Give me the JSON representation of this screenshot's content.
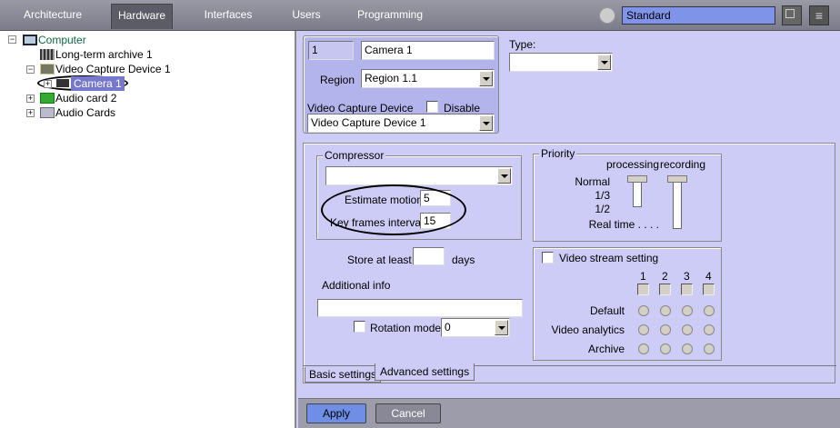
{
  "topbar": {
    "tabs": [
      "Architecture",
      "Hardware",
      "Interfaces",
      "Users",
      "Programming"
    ],
    "active_tab": "Hardware",
    "layout_select": "Standard"
  },
  "tree": {
    "items": [
      {
        "label": "Computer"
      },
      {
        "label": "Long-term archive 1"
      },
      {
        "label": "Video Capture Device 1"
      },
      {
        "label": "Camera 1"
      },
      {
        "label": "Audio card 2"
      },
      {
        "label": "Audio Cards"
      }
    ]
  },
  "camera": {
    "id": "1",
    "name": "Camera 1",
    "region_label": "Region",
    "region_value": "Region 1.1",
    "vcd_label": "Video Capture Device",
    "disable_label": "Disable",
    "vcd_value": "Video Capture Device 1",
    "type_label": "Type:",
    "type_value": ""
  },
  "compressor": {
    "title": "Compressor",
    "value": "",
    "estimate_motion_label": "Estimate motion",
    "estimate_motion_value": "5",
    "key_frames_label": "Key frames interval",
    "key_frames_value": "15"
  },
  "store": {
    "label": "Store at least",
    "value": "",
    "unit": "days"
  },
  "additional_info": {
    "label": "Additional info",
    "value": ""
  },
  "rotation": {
    "label": "Rotation mode",
    "value": "0"
  },
  "priority": {
    "title": "Priority",
    "col_processing": "processing",
    "col_recording": "recording",
    "levels": [
      "Normal",
      "1/3",
      "1/2",
      "Real time . . . ."
    ],
    "processing_level": "Normal",
    "recording_level": "Normal"
  },
  "stream": {
    "title": "Video stream setting",
    "columns": [
      "1",
      "2",
      "3",
      "4"
    ],
    "rows": [
      "Default",
      "Video analytics",
      "Archive"
    ]
  },
  "tabs": {
    "basic": "Basic settings",
    "advanced": "Advanced settings"
  },
  "buttons": {
    "apply": "Apply",
    "cancel": "Cancel"
  }
}
